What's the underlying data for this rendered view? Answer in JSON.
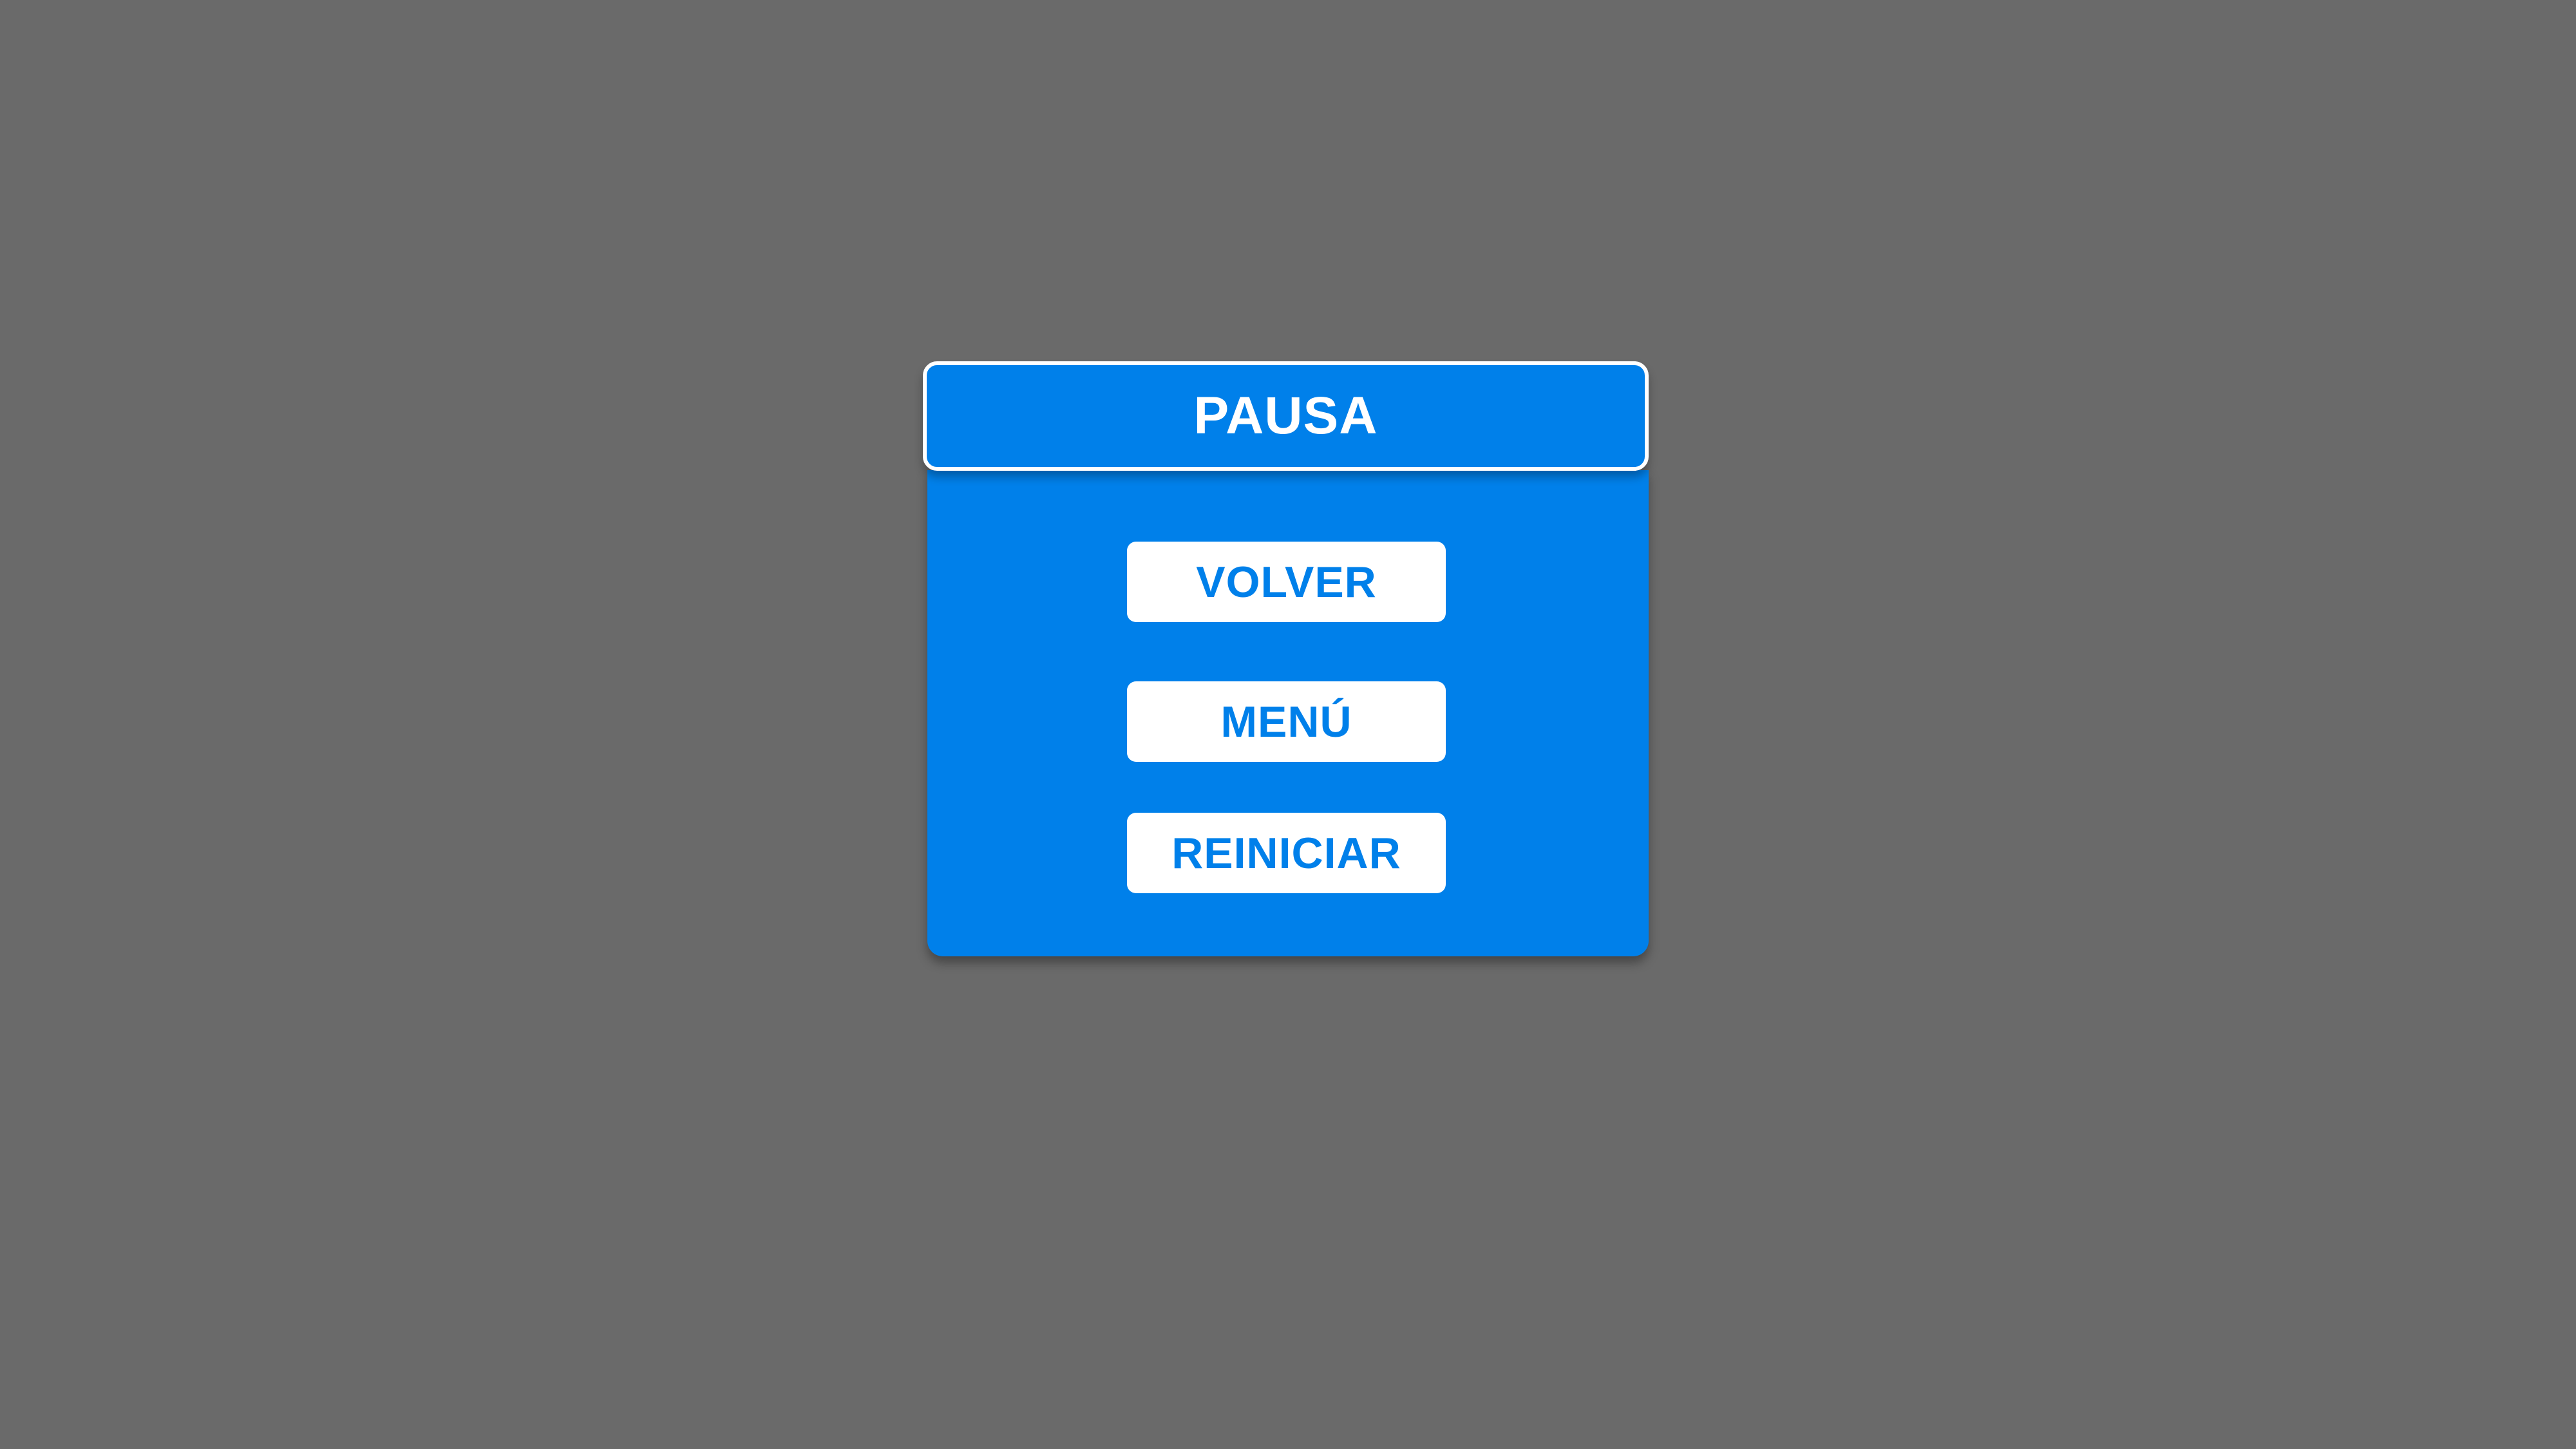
{
  "pause_menu": {
    "title": "PAUSA",
    "buttons": {
      "resume_label": "VOLVER",
      "menu_label": "MENÚ",
      "restart_label": "REINICIAR"
    }
  },
  "colors": {
    "background": "#6a6a6a",
    "panel": "#0080ea",
    "button": "#ffffff",
    "button_text": "#0080ea"
  }
}
